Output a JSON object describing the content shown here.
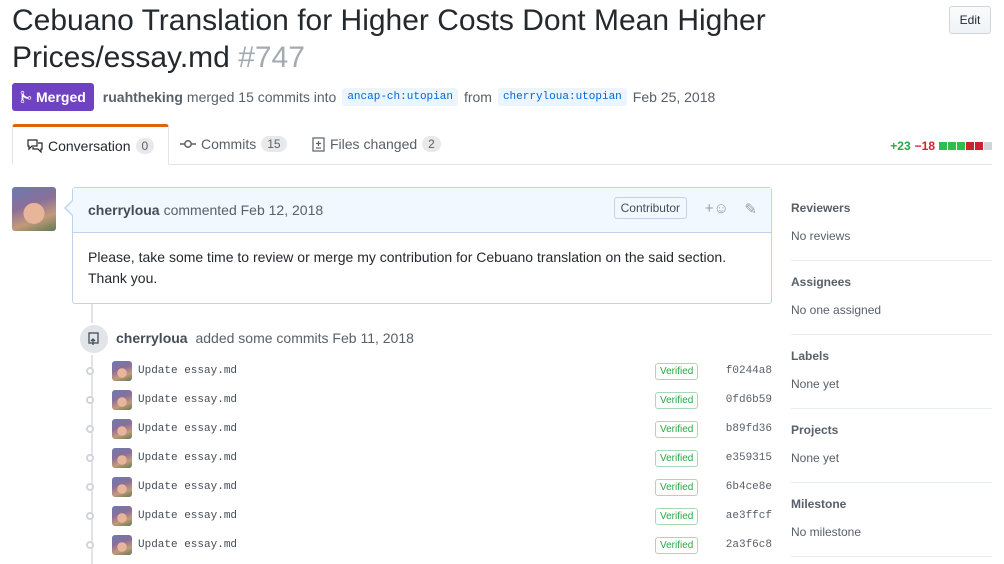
{
  "pr": {
    "title": "Cebuano Translation for Higher Costs Dont Mean Higher Prices/essay.md",
    "number": "#747",
    "edit_label": "Edit",
    "state": "Merged",
    "author": "ruahtheking",
    "merge_text": "merged 15 commits into",
    "base_branch": "ancap-ch:utopian",
    "from_text": "from",
    "head_branch": "cherryloua:utopian",
    "date": "Feb 25, 2018"
  },
  "tabs": [
    {
      "label": "Conversation",
      "count": "0",
      "icon": "comment-discussion-icon"
    },
    {
      "label": "Commits",
      "count": "15",
      "icon": "git-commit-icon"
    },
    {
      "label": "Files changed",
      "count": "2",
      "icon": "diff-icon"
    }
  ],
  "diffstat": {
    "additions": "+23",
    "deletions": "−18"
  },
  "comment": {
    "author": "cherryloua",
    "action": "commented Feb 12, 2018",
    "role": "Contributor",
    "body": "Please, take some time to review or merge my contribution for Cebuano translation on the said section. Thank you."
  },
  "event": {
    "author": "cherryloua",
    "text": "added some commits Feb 11, 2018"
  },
  "commits": [
    {
      "message": "Update essay.md",
      "verified": "Verified",
      "sha": "f0244a8"
    },
    {
      "message": "Update essay.md",
      "verified": "Verified",
      "sha": "0fd6b59"
    },
    {
      "message": "Update essay.md",
      "verified": "Verified",
      "sha": "b89fd36"
    },
    {
      "message": "Update essay.md",
      "verified": "Verified",
      "sha": "e359315"
    },
    {
      "message": "Update essay.md",
      "verified": "Verified",
      "sha": "6b4ce8e"
    },
    {
      "message": "Update essay.md",
      "verified": "Verified",
      "sha": "ae3ffcf"
    },
    {
      "message": "Update essay.md",
      "verified": "Verified",
      "sha": "2a3f6c8"
    }
  ],
  "sidebar": [
    {
      "heading": "Reviewers",
      "value": "No reviews"
    },
    {
      "heading": "Assignees",
      "value": "No one assigned"
    },
    {
      "heading": "Labels",
      "value": "None yet"
    },
    {
      "heading": "Projects",
      "value": "None yet"
    },
    {
      "heading": "Milestone",
      "value": "No milestone"
    }
  ],
  "colors": {
    "merged": "#6f42c1",
    "additions": "#28a745",
    "deletions": "#cb2431",
    "tab_accent": "#e36209"
  }
}
